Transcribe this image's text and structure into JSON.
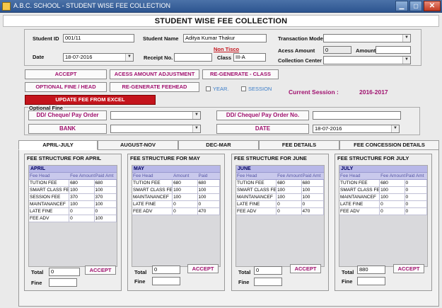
{
  "window": {
    "title": "A.B.C. SCHOOL - STUDENT WISE FEE COLLECTION",
    "minimize": "▁",
    "maximize": "▢",
    "close": "✕"
  },
  "page_title": "STUDENT WISE FEE COLLECTION",
  "form": {
    "student_id_label": "Student ID",
    "student_id": "001/11",
    "student_name_label": "Student Name",
    "student_name": "Aditya Kumar Thakur",
    "non_tisco": "Non Tisco",
    "transaction_mode_label": "Transaction Mode",
    "transaction_mode": "",
    "date_label": "Date",
    "date": "18-07-2016",
    "receipt_label": "Receipt No.",
    "receipt_no": "",
    "class_label": "Class",
    "class_value": "III-A",
    "access_amount_label": "Acess Amount",
    "access_amount": "0",
    "amount_label": "Amount",
    "amount": "",
    "collection_center_label": "Collection Center",
    "collection_center": ""
  },
  "buttons": {
    "accept": "ACCEPT",
    "access_adjust": "ACESS AMOUNT ADJUSTMENT",
    "regen_class": "RE-GENERATE - CLASS",
    "optional_fine": "OPTIONAL FINE / HEAD",
    "regen_feehead": "RE-GENERATE FEEHEAD",
    "update_excel": "UPDATE FEE FROM EXCEL"
  },
  "checks": {
    "year": "YEAR.",
    "session": "SESSION"
  },
  "session": {
    "label": "Current Session :",
    "value": "2016-2017"
  },
  "fine": {
    "group_label": "Optional Fine",
    "dd_cheque_1": "DD/ Cheque/ Pay Order",
    "dd_cheque_2": "DD/ Cheque/ Pay Order No.",
    "bank": "BANK",
    "date_btn": "DATE",
    "date_value": "18-07-2016",
    "dd_select": "",
    "bank_select": "",
    "dd_no": ""
  },
  "tabs": [
    {
      "label": "APRIL-JULY"
    },
    {
      "label": "AUGUST-NOV"
    },
    {
      "label": "DEC-MAR"
    },
    {
      "label": "FEE DETAILS"
    },
    {
      "label": "FEE CONCESSION DETAILS"
    }
  ],
  "sections": [
    {
      "title": "FEE STRUCTURE FOR APRIL",
      "grid_title": "APRIL",
      "headers": [
        "Fee Head",
        "Fee Amount",
        "Paid Amt"
      ],
      "rows": [
        [
          "TUTION FEE",
          "680",
          "680"
        ],
        [
          "SMART CLASS FE",
          "100",
          "100"
        ],
        [
          "SESSION FEE",
          "370",
          "370"
        ],
        [
          "MAINTANANCEF",
          "100",
          "100"
        ],
        [
          "LATE FINE",
          "0",
          "0"
        ],
        [
          "FEE ADV",
          "0",
          "100"
        ]
      ],
      "total_label": "Total",
      "total": "0",
      "fine_label": "Fine",
      "fine": "",
      "accept": "ACCEPT"
    },
    {
      "title": "FEE STRUCTURE FOR MAY",
      "grid_title": "MAY",
      "headers": [
        "Fee Head",
        "Amount",
        "Paid"
      ],
      "rows": [
        [
          "TUTION FEE",
          "680",
          "680"
        ],
        [
          "SMART CLASS FE",
          "100",
          "100"
        ],
        [
          "MAINTANANCEF",
          "100",
          "100"
        ],
        [
          "LATE FINE",
          "0",
          "0"
        ],
        [
          "FEE ADV",
          "0",
          "470"
        ]
      ],
      "total_label": "Total",
      "total": "0",
      "fine_label": "Fine",
      "fine": "",
      "accept": "ACCEPT"
    },
    {
      "title": "FEE STRUCTURE FOR JUNE",
      "grid_title": "JUNE",
      "headers": [
        "Fee Head",
        "Fee Amount",
        "Paid Amt"
      ],
      "rows": [
        [
          "TUTION FEE",
          "680",
          "680"
        ],
        [
          "SMART CLASS FE",
          "100",
          "100"
        ],
        [
          "MAINTANANCEF",
          "100",
          "100"
        ],
        [
          "LATE FINE",
          "0",
          "0"
        ],
        [
          "FEE ADV",
          "0",
          "470"
        ]
      ],
      "total_label": "Total",
      "total": "0",
      "fine_label": "Fine",
      "fine": "",
      "accept": "ACCEPT"
    },
    {
      "title": "FEE STRUCTURE FOR JULY",
      "grid_title": "JULY",
      "headers": [
        "Fee Head",
        "Fee Amount",
        "Paid Amt"
      ],
      "rows": [
        [
          "TUTION FEE",
          "680",
          "0"
        ],
        [
          "SMART CLASS FE",
          "100",
          "0"
        ],
        [
          "MAINTANANCEF",
          "100",
          "0"
        ],
        [
          "LATE FINE",
          "0",
          "0"
        ],
        [
          "FEE ADV",
          "0",
          "0"
        ]
      ],
      "total_label": "Total",
      "total": "880",
      "fine_label": "Fine",
      "fine": "",
      "accept": "ACCEPT"
    }
  ]
}
